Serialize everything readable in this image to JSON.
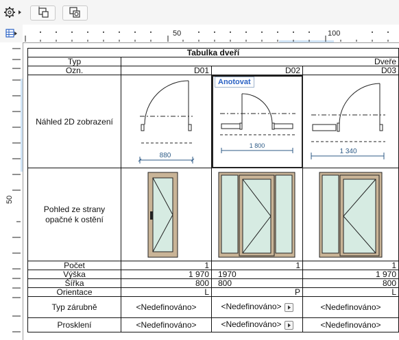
{
  "toolbar": {
    "buttons": [
      {
        "icon": "gear-icon"
      },
      {
        "icon": "schedule-fit-icon"
      },
      {
        "icon": "schedule-merge-icon"
      }
    ]
  },
  "ruler": {
    "top_labels": [
      "50",
      "100"
    ],
    "left_labels": [
      "50"
    ]
  },
  "schedule": {
    "title": "Tabulka dveří",
    "header_rows": [
      {
        "label": "Typ",
        "values": [
          "",
          "",
          "Dveře"
        ]
      },
      {
        "label": "Ozn.",
        "values": [
          "D01",
          "D02",
          "D03"
        ]
      }
    ],
    "preview_2d_label": "Náhled 2D zobrazení",
    "annotate_label": "Anotovat",
    "widths": [
      "880",
      "1 800",
      "1 340"
    ],
    "elevation_label_line1": "Pohled ze strany",
    "elevation_label_line2": "opačné k ostění",
    "rows": [
      {
        "label": "Počet",
        "values": [
          "1",
          "",
          "1"
        ]
      },
      {
        "label": "Výška",
        "values": [
          "1 970",
          "1970",
          "1 970"
        ]
      },
      {
        "label": "Šířka",
        "values": [
          "800",
          "800",
          "800"
        ]
      },
      {
        "label": "Orientace",
        "values": [
          "L",
          "P",
          "L"
        ]
      },
      {
        "label": "Typ zárubně",
        "values": [
          "<Nedefinováno>",
          "<Nedefinováno>",
          "<Nedefinováno>"
        ]
      },
      {
        "label": "Prosklení",
        "values": [
          "<Nedefinováno>",
          "<Nedefinováno>",
          "<Nedefinováno>"
        ]
      }
    ]
  },
  "colors": {
    "frame_brown": "#c9b497",
    "glass": "#d6ebe2",
    "dimension_blue": "#2c5a86",
    "accent_blue": "#2a62c4"
  }
}
